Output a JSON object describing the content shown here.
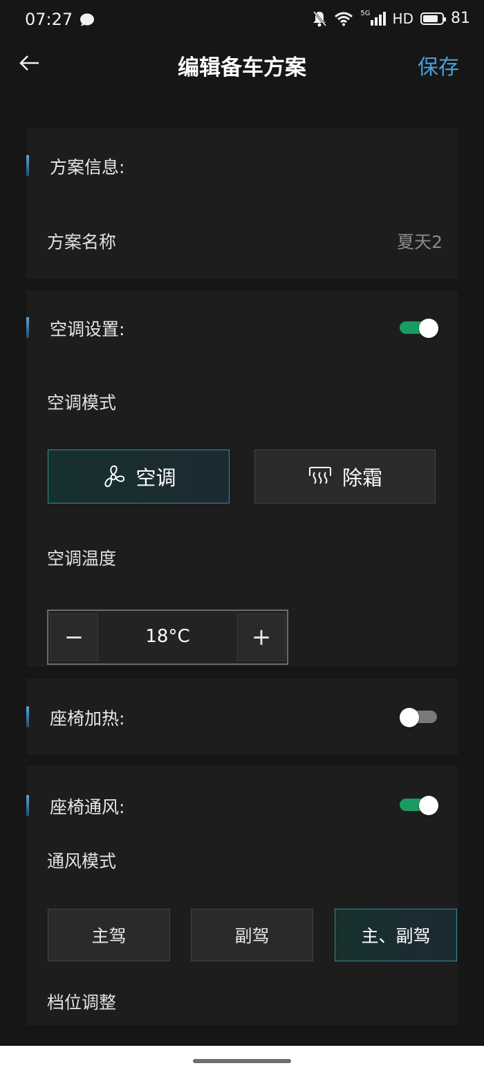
{
  "status_bar": {
    "time": "07:27",
    "network": "5G",
    "hd": "HD",
    "battery_level": "81",
    "battery_fraction": 0.81
  },
  "header": {
    "title": "编辑备车方案",
    "save_label": "保存",
    "accent_color": "#4aa0d8"
  },
  "plan_info": {
    "section_title": "方案信息:",
    "name_label": "方案名称",
    "name_value": "夏天2"
  },
  "ac": {
    "section_title": "空调设置:",
    "enabled": true,
    "mode_label": "空调模式",
    "modes": [
      {
        "label": "空调",
        "icon": "fan-icon",
        "selected": true
      },
      {
        "label": "除霜",
        "icon": "defrost-icon",
        "selected": false
      }
    ],
    "temp_label": "空调温度",
    "temperature": "18°C",
    "minus": "−",
    "plus": "+"
  },
  "seat_heating": {
    "section_title": "座椅加热:",
    "enabled": false
  },
  "seat_ventilation": {
    "section_title": "座椅通风:",
    "enabled": true,
    "mode_label": "通风模式",
    "modes": [
      {
        "label": "主驾",
        "selected": false
      },
      {
        "label": "副驾",
        "selected": false
      },
      {
        "label": "主、副驾",
        "selected": true
      }
    ],
    "gear_label": "档位调整"
  },
  "colors": {
    "toggle_on": "#1a9b61",
    "toggle_off": "#7a7a7a",
    "selected_border": "#2f8f8f"
  }
}
